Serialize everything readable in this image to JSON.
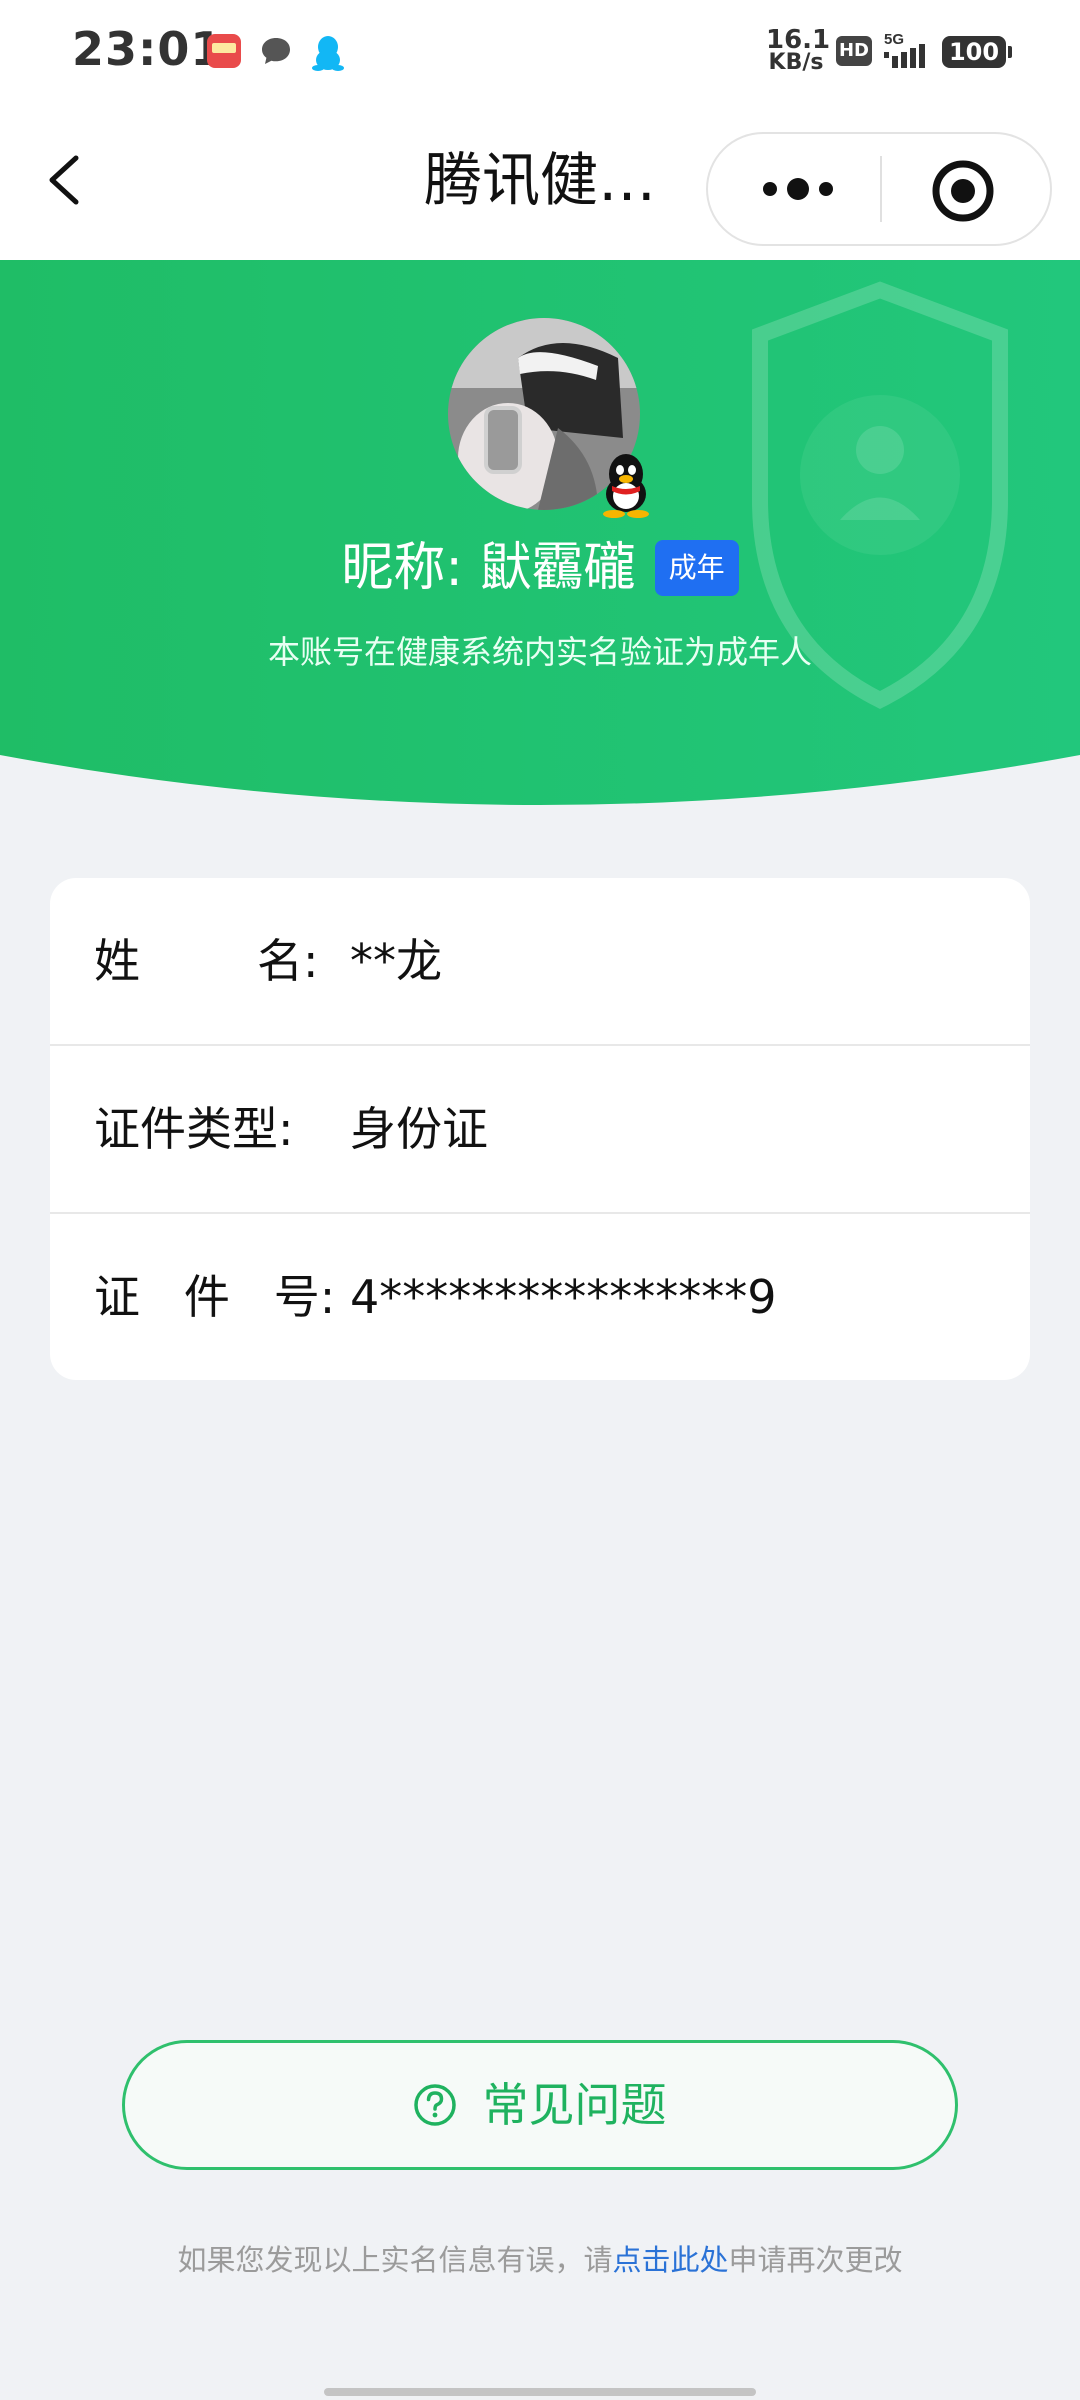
{
  "status_bar": {
    "time": "23:01",
    "speed_value": "16.1",
    "speed_unit": "KB/s",
    "hd_label": "HD",
    "network": "5G",
    "battery": "100",
    "app_icons": [
      "shopping-app-icon",
      "chat-bubble-icon",
      "qq-penguin-icon"
    ]
  },
  "navbar": {
    "title": "腾讯健…",
    "back_icon": "chevron-left-icon",
    "more_icon": "more-dots-icon",
    "close_icon": "target-close-icon"
  },
  "profile": {
    "nickname": "昵称: 鼣靏礲",
    "badge": "成年",
    "verify_text": "本账号在健康系统内实名验证为成年人"
  },
  "info": {
    "rows": [
      {
        "label": "姓        名:",
        "value": "**龙"
      },
      {
        "label": "证件类型:",
        "value": "身份证"
      },
      {
        "label": "证   件   号:",
        "value": "4****************9"
      }
    ]
  },
  "faq": {
    "label": "常见问题",
    "icon": "question-circle-icon"
  },
  "footer": {
    "prefix": "如果您发现以上实名信息有误，请",
    "link": "点击此处",
    "suffix": "申请再次更改"
  },
  "colors": {
    "brand_green": "#1fc16e",
    "badge_blue": "#1f6ff2",
    "link_blue": "#2a72d6",
    "page_bg": "#f0f2f5"
  }
}
